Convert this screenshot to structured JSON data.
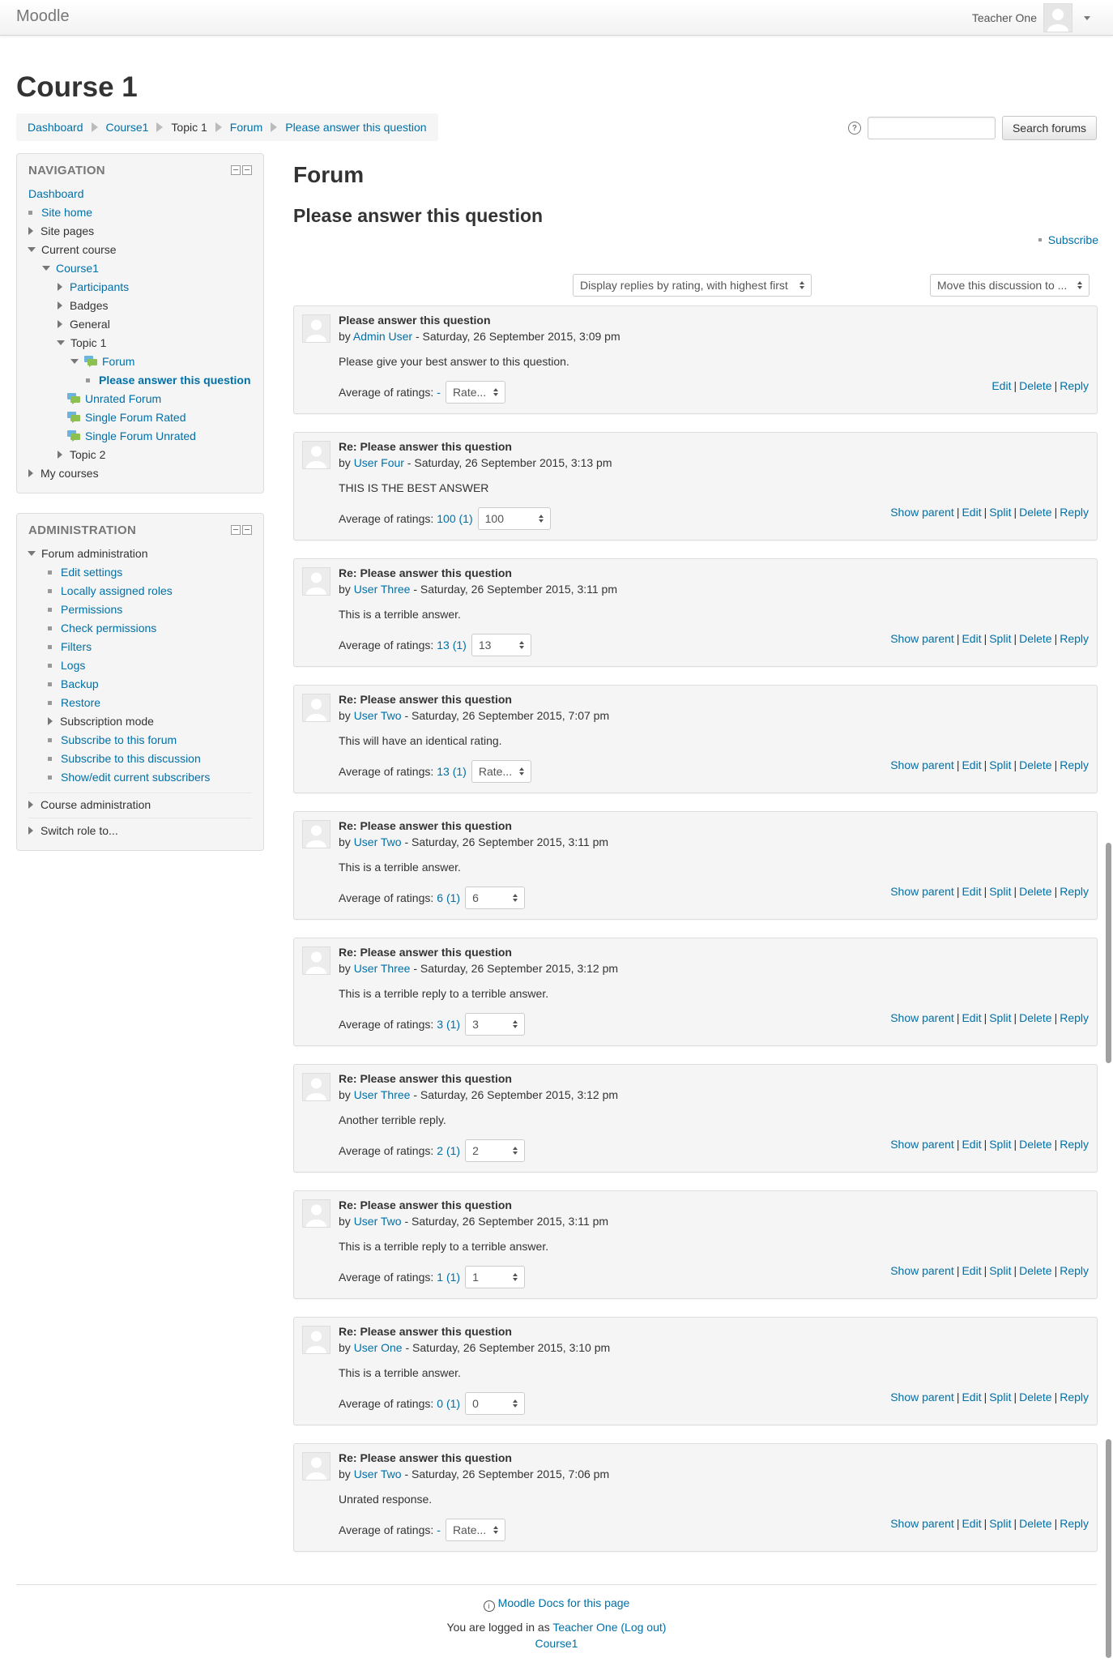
{
  "navbar": {
    "brand": "Moodle",
    "user_name": "Teacher One"
  },
  "header": {
    "course_title": "Course 1",
    "breadcrumb": [
      "Dashboard",
      "Course1",
      "Topic 1",
      "Forum",
      "Please answer this question"
    ],
    "search_button": "Search forums",
    "search_placeholder": ""
  },
  "navigation": {
    "title": "NAVIGATION",
    "items": [
      "Dashboard",
      "Site home",
      "Site pages",
      "Current course",
      "Course1",
      "Participants",
      "Badges",
      "General",
      "Topic 1",
      "Forum",
      "Please answer this question",
      "Unrated Forum",
      "Single Forum Rated",
      "Single Forum Unrated",
      "Topic 2",
      "My courses"
    ]
  },
  "administration": {
    "title": "ADMINISTRATION",
    "items": [
      "Forum administration",
      "Edit settings",
      "Locally assigned roles",
      "Permissions",
      "Check permissions",
      "Filters",
      "Logs",
      "Backup",
      "Restore",
      "Subscription mode",
      "Subscribe to this forum",
      "Subscribe to this discussion",
      "Show/edit current subscribers",
      "Course administration",
      "Switch role to..."
    ]
  },
  "main": {
    "title": "Forum",
    "discussion_title": "Please answer this question",
    "subscribe": "Subscribe",
    "display_mode": "Display replies by rating, with highest first",
    "move_discussion": "Move this discussion to ..."
  },
  "labels": {
    "by": "by",
    "avg": "Average of ratings:",
    "show_parent": "Show parent",
    "edit": "Edit",
    "split": "Split",
    "delete": "Delete",
    "reply": "Reply"
  },
  "posts": [
    {
      "subject": "Please answer this question",
      "author": "Admin User",
      "date": " - Saturday, 26 September 2015, 3:09 pm",
      "body": "Please give your best answer to this question.",
      "avg": "-",
      "rate": "Rate...",
      "first": true
    },
    {
      "subject": "Re: Please answer this question",
      "author": "User Four",
      "date": " - Saturday, 26 September 2015, 3:13 pm",
      "body": "THIS IS THE BEST ANSWER",
      "avg": "100 (1)",
      "rate": "100"
    },
    {
      "subject": "Re: Please answer this question",
      "author": "User Three",
      "date": " - Saturday, 26 September 2015, 3:11 pm",
      "body": "This is a terrible answer.",
      "avg": "13 (1)",
      "rate": "13"
    },
    {
      "subject": "Re: Please answer this question",
      "author": "User Two",
      "date": " - Saturday, 26 September 2015, 7:07 pm",
      "body": "This will have an identical rating.",
      "avg": "13 (1)",
      "rate": "Rate..."
    },
    {
      "subject": "Re: Please answer this question",
      "author": "User Two",
      "date": " - Saturday, 26 September 2015, 3:11 pm",
      "body": "This is a terrible answer.",
      "avg": "6 (1)",
      "rate": "6"
    },
    {
      "subject": "Re: Please answer this question",
      "author": "User Three",
      "date": " - Saturday, 26 September 2015, 3:12 pm",
      "body": "This is a terrible reply to a terrible answer.",
      "avg": "3 (1)",
      "rate": "3"
    },
    {
      "subject": "Re: Please answer this question",
      "author": "User Three",
      "date": " - Saturday, 26 September 2015, 3:12 pm",
      "body": "Another terrible reply.",
      "avg": "2 (1)",
      "rate": "2"
    },
    {
      "subject": "Re: Please answer this question",
      "author": "User Two",
      "date": " - Saturday, 26 September 2015, 3:11 pm",
      "body": "This is a terrible reply to a terrible answer.",
      "avg": "1 (1)",
      "rate": "1"
    },
    {
      "subject": "Re: Please answer this question",
      "author": "User One",
      "date": " - Saturday, 26 September 2015, 3:10 pm",
      "body": "This is a terrible answer.",
      "avg": "0 (1)",
      "rate": "0"
    },
    {
      "subject": "Re: Please answer this question",
      "author": "User Two",
      "date": " - Saturday, 26 September 2015, 7:06 pm",
      "body": "Unrated response.",
      "avg": "-",
      "rate": "Rate..."
    }
  ],
  "footer": {
    "docs_link": "Moodle Docs for this page",
    "logged_in_prefix": "You are logged in as ",
    "user": "Teacher One",
    "logout": "(Log out)",
    "course": "Course1"
  },
  "colors": {
    "link": "#0070a8",
    "block_bg": "#f5f5f5",
    "post_bg": "#f5f5f5"
  },
  "icons": [
    "user-avatar-icon",
    "caret-down-icon",
    "help-icon",
    "forum-icon",
    "info-icon",
    "expand-icon",
    "collapse-icon"
  ]
}
